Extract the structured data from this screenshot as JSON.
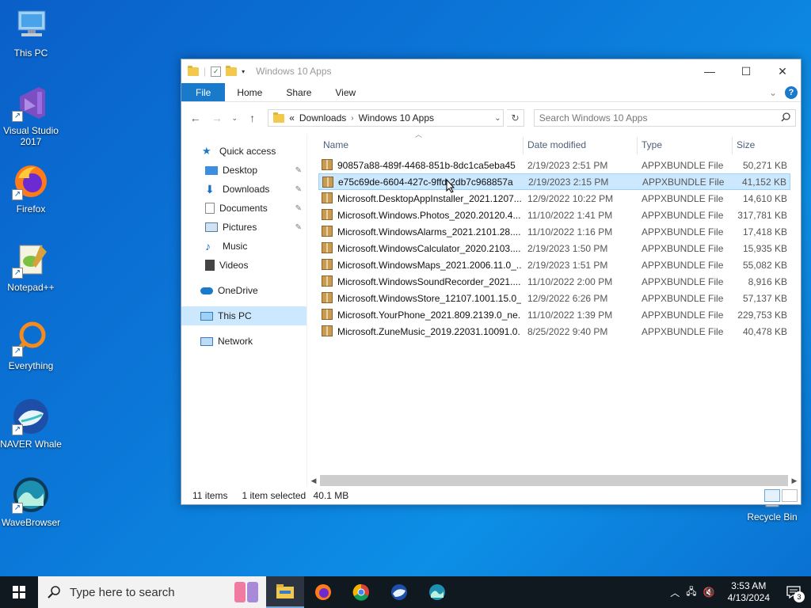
{
  "desktop": {
    "icons": [
      {
        "label": "This PC",
        "icon": "computer-icon"
      },
      {
        "label": "Visual Studio 2017",
        "icon": "visual-studio-icon"
      },
      {
        "label": "Firefox",
        "icon": "firefox-icon"
      },
      {
        "label": "Notepad++",
        "icon": "notepadpp-icon"
      },
      {
        "label": "Everything",
        "icon": "everything-search-icon"
      },
      {
        "label": "NAVER Whale",
        "icon": "naver-whale-icon"
      },
      {
        "label": "WaveBrowser",
        "icon": "wavebrowser-icon"
      },
      {
        "label": "Recycle Bin",
        "icon": "recycle-bin-icon"
      }
    ]
  },
  "window": {
    "title": "Windows 10 Apps",
    "controls": {
      "minimize": "—",
      "maximize": "☐",
      "close": "✕"
    },
    "ribbon": {
      "file": "File",
      "home": "Home",
      "share": "Share",
      "view": "View",
      "expand": "⌄",
      "help": "?"
    },
    "address": {
      "prefix": "«",
      "crumbs": [
        "Downloads",
        "Windows 10 Apps"
      ]
    },
    "search": {
      "placeholder": "Search Windows 10 Apps"
    },
    "nav": {
      "quick_access": "Quick access",
      "items": [
        {
          "label": "Desktop",
          "pinned": true
        },
        {
          "label": "Downloads",
          "pinned": true
        },
        {
          "label": "Documents",
          "pinned": true
        },
        {
          "label": "Pictures",
          "pinned": true
        },
        {
          "label": "Music",
          "pinned": false
        },
        {
          "label": "Videos",
          "pinned": false
        }
      ],
      "onedrive": "OneDrive",
      "this_pc": "This PC",
      "network": "Network"
    },
    "columns": {
      "name": "Name",
      "date": "Date modified",
      "type": "Type",
      "size": "Size"
    },
    "files": [
      {
        "name": "90857a88-489f-4468-851b-8dc1ca5eba45",
        "date": "2/19/2023 2:51 PM",
        "type": "APPXBUNDLE File",
        "size": "50,271 KB"
      },
      {
        "name": "e75c69de-6604-427c-9ffd-2db7c968857a",
        "date": "2/19/2023 2:15 PM",
        "type": "APPXBUNDLE File",
        "size": "41,152 KB",
        "selected": true
      },
      {
        "name": "Microsoft.DesktopAppInstaller_2021.1207....",
        "date": "12/9/2022 10:22 PM",
        "type": "APPXBUNDLE File",
        "size": "14,610 KB"
      },
      {
        "name": "Microsoft.Windows.Photos_2020.20120.4....",
        "date": "11/10/2022 1:41 PM",
        "type": "APPXBUNDLE File",
        "size": "317,781 KB"
      },
      {
        "name": "Microsoft.WindowsAlarms_2021.2101.28....",
        "date": "11/10/2022 1:16 PM",
        "type": "APPXBUNDLE File",
        "size": "17,418 KB"
      },
      {
        "name": "Microsoft.WindowsCalculator_2020.2103....",
        "date": "2/19/2023 1:50 PM",
        "type": "APPXBUNDLE File",
        "size": "15,935 KB"
      },
      {
        "name": "Microsoft.WindowsMaps_2021.2006.11.0_...",
        "date": "2/19/2023 1:51 PM",
        "type": "APPXBUNDLE File",
        "size": "55,082 KB"
      },
      {
        "name": "Microsoft.WindowsSoundRecorder_2021....",
        "date": "11/10/2022 2:00 PM",
        "type": "APPXBUNDLE File",
        "size": "8,916 KB"
      },
      {
        "name": "Microsoft.WindowsStore_12107.1001.15.0_...",
        "date": "12/9/2022 6:26 PM",
        "type": "APPXBUNDLE File",
        "size": "57,137 KB"
      },
      {
        "name": "Microsoft.YourPhone_2021.809.2139.0_ne...",
        "date": "11/10/2022 1:39 PM",
        "type": "APPXBUNDLE File",
        "size": "229,753 KB"
      },
      {
        "name": "Microsoft.ZuneMusic_2019.22031.10091.0...",
        "date": "8/25/2022 9:40 PM",
        "type": "APPXBUNDLE File",
        "size": "40,478 KB"
      }
    ],
    "status": {
      "count": "11 items",
      "selected": "1 item selected",
      "size": "40.1 MB"
    }
  },
  "taskbar": {
    "search_placeholder": "Type here to search",
    "time": "3:53 AM",
    "date": "4/13/2024",
    "notification_count": "3"
  }
}
